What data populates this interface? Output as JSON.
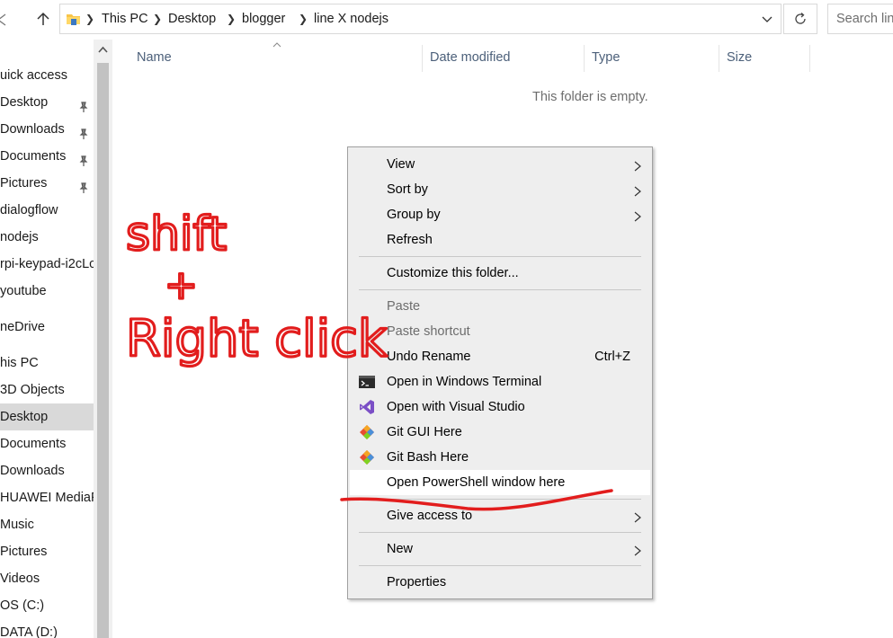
{
  "address_bar": {
    "breadcrumbs": [
      "This PC",
      "Desktop",
      "blogger",
      "line X nodejs"
    ]
  },
  "search": {
    "placeholder": "Search line X nodejs"
  },
  "nav_pane": {
    "items": [
      {
        "label": "uick access",
        "pinned": false,
        "selected": false
      },
      {
        "label": "Desktop",
        "pinned": true,
        "selected": false
      },
      {
        "label": "Downloads",
        "pinned": true,
        "selected": false
      },
      {
        "label": "Documents",
        "pinned": true,
        "selected": false
      },
      {
        "label": "Pictures",
        "pinned": true,
        "selected": false
      },
      {
        "label": "dialogflow",
        "pinned": false,
        "selected": false
      },
      {
        "label": "nodejs",
        "pinned": false,
        "selected": false
      },
      {
        "label": "rpi-keypad-i2cLc",
        "pinned": false,
        "selected": false
      },
      {
        "label": "youtube",
        "pinned": false,
        "selected": false
      },
      {
        "label": "neDrive",
        "pinned": false,
        "selected": false
      },
      {
        "label": "his PC",
        "pinned": false,
        "selected": false
      },
      {
        "label": "3D Objects",
        "pinned": false,
        "selected": false
      },
      {
        "label": "Desktop",
        "pinned": false,
        "selected": true
      },
      {
        "label": "Documents",
        "pinned": false,
        "selected": false
      },
      {
        "label": "Downloads",
        "pinned": false,
        "selected": false
      },
      {
        "label": "HUAWEI MediaP",
        "pinned": false,
        "selected": false
      },
      {
        "label": "Music",
        "pinned": false,
        "selected": false
      },
      {
        "label": "Pictures",
        "pinned": false,
        "selected": false
      },
      {
        "label": "Videos",
        "pinned": false,
        "selected": false
      },
      {
        "label": "OS (C:)",
        "pinned": false,
        "selected": false
      },
      {
        "label": "DATA (D:)",
        "pinned": false,
        "selected": false
      }
    ]
  },
  "file_list": {
    "columns": [
      "Name",
      "Date modified",
      "Type",
      "Size"
    ],
    "empty_message": "This folder is empty."
  },
  "context_menu": {
    "items": [
      {
        "label": "View",
        "submenu": true
      },
      {
        "label": "Sort by",
        "submenu": true
      },
      {
        "label": "Group by",
        "submenu": true
      },
      {
        "label": "Refresh"
      },
      {
        "label": "Customize this folder..."
      },
      {
        "label": "Paste",
        "disabled": true
      },
      {
        "label": "Paste shortcut",
        "disabled": true
      },
      {
        "label": "Undo Rename",
        "shortcut": "Ctrl+Z"
      },
      {
        "label": "Open in Windows Terminal",
        "icon": "terminal-icon"
      },
      {
        "label": "Open with Visual Studio",
        "icon": "visual-studio-icon"
      },
      {
        "label": "Git GUI Here",
        "icon": "git-icon"
      },
      {
        "label": "Git Bash Here",
        "icon": "git-icon"
      },
      {
        "label": "Open PowerShell window here",
        "highlighted": true
      },
      {
        "label": "Give access to",
        "submenu": true
      },
      {
        "label": "New",
        "submenu": true
      },
      {
        "label": "Properties"
      }
    ]
  },
  "annotation": {
    "lines": [
      "shift",
      "+",
      "Right click"
    ],
    "color": "#e21d1d"
  },
  "colors": {
    "header_text": "#4c607a",
    "selected_nav": "#d9d9d9",
    "menu_bg": "#eeeeee",
    "folder_yellow": "#f8c54a"
  }
}
